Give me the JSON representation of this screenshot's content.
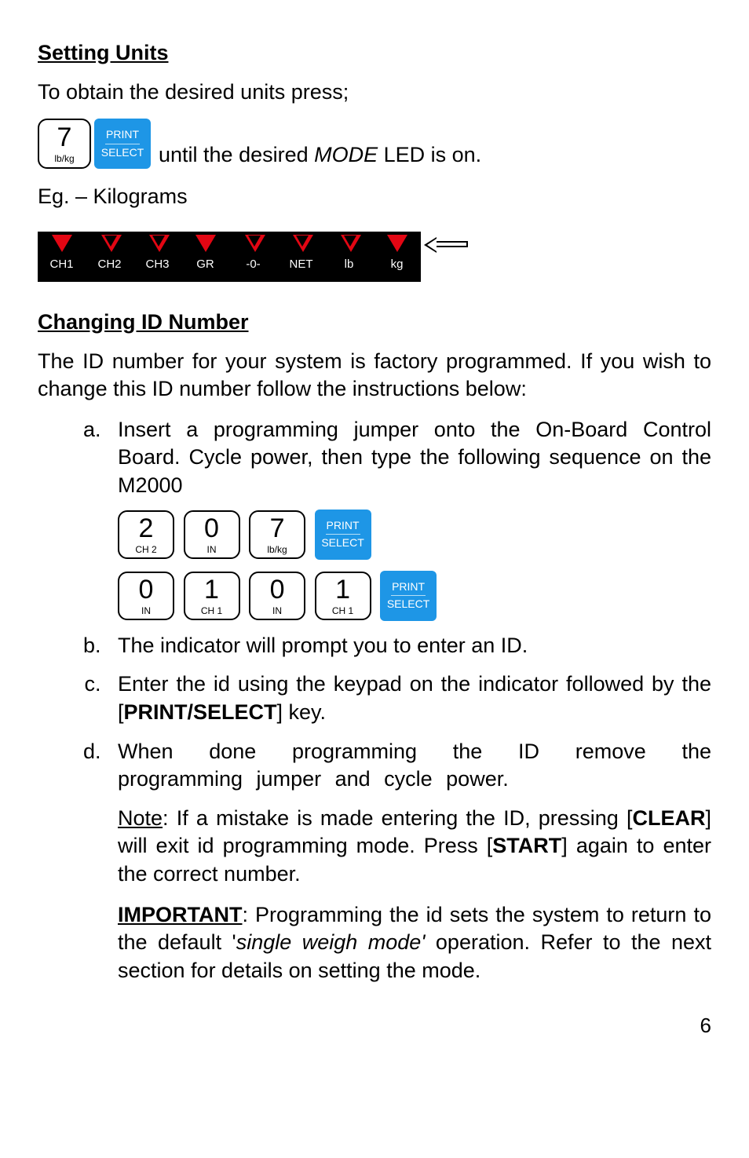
{
  "sec1_title": "Setting Units",
  "sec1_intro": "To obtain the desired units press;",
  "sec1_until_pre": " until the desired ",
  "sec1_until_mode": "MODE",
  "sec1_until_post": " LED is on.",
  "sec1_eg": "Eg. – Kilograms",
  "key7_num": "7",
  "key7_lbl": "lb/kg",
  "ps_print": "PRINT",
  "ps_select": "SELECT",
  "led": {
    "ch1": "CH1",
    "ch2": "CH2",
    "ch3": "CH3",
    "gr": "GR",
    "zero": "-0-",
    "net": "NET",
    "lb": "lb",
    "kg": "kg"
  },
  "sec2_title": "Changing ID Number",
  "sec2_intro": "The ID number for your system is factory programmed. If you wish to change this ID number follow the instructions below:",
  "li_a": "Insert a programming jumper onto the On-Board Control Board. Cycle power, then type the following sequence on the M2000",
  "li_b": "The indicator will prompt you to enter an ID.",
  "li_c_pre": "Enter the id using the keypad on the indicator followed by the [",
  "li_c_key": "PRINT/SELECT",
  "li_c_post": "] key.",
  "li_d": "When done programming the ID remove the programming jumper and cycle power.",
  "k2n": "2",
  "k2l": "CH 2",
  "k0n": "0",
  "k0l": "IN",
  "k1n": "1",
  "k1l": "CH 1",
  "note_label": "Note",
  "note_1": ": If a mistake is made entering the ID, pressing [",
  "note_clear": "CLEAR",
  "note_2": "] will exit id programming mode. Press [",
  "note_start": "START",
  "note_3": "] again to enter the correct number.",
  "imp_label": "IMPORTANT",
  "imp_1": ": Programming the id sets the system to return to the default '",
  "imp_mode": "single weigh mode'",
  "imp_2": " operation. Refer to the next section for details on setting the mode.",
  "pagenum": "6"
}
